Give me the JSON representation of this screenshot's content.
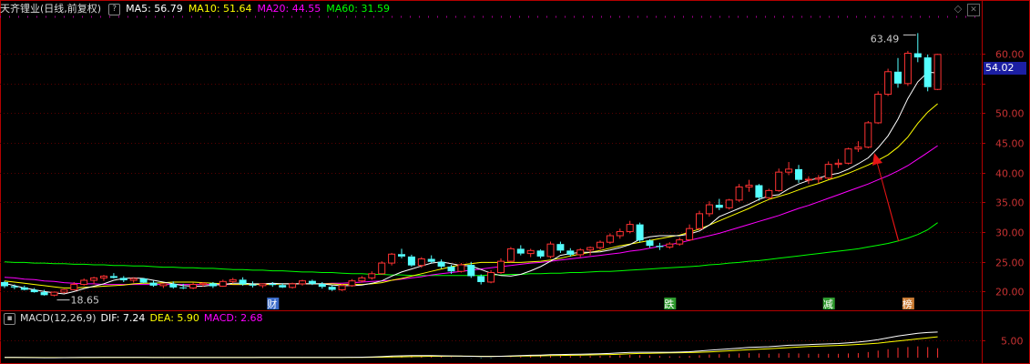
{
  "header": {
    "title": "天齐锂业(日线,前复权)",
    "ma5": "MA5: 56.79",
    "ma10": "MA10: 51.64",
    "ma20": "MA20: 44.55",
    "ma60": "MA60: 31.59"
  },
  "macd_header": {
    "title": "MACD(12,26,9)",
    "dif": "DIF: 7.24",
    "dea": "DEA: 5.90",
    "macd": "MACD: 2.68"
  },
  "last_price": "54.02",
  "colors": {
    "up": "#ff3232",
    "down": "#54ffff",
    "ma5": "#ffffff",
    "ma10": "#ffff00",
    "ma20": "#ff00ff",
    "ma60": "#00ff00",
    "axis": "#b40000",
    "axis_text": "#c83232",
    "arrow": "#e61414"
  },
  "chart_data": {
    "type": "candlestick",
    "ylim": [
      17,
      66
    ],
    "y_ticks": [
      20,
      25,
      30,
      35,
      40,
      45,
      50,
      55,
      60
    ],
    "y_tick_labels": [
      "20.00",
      "25.00",
      "30.00",
      "35.00",
      "40.00",
      "45.00",
      "50.00",
      "",
      "60.00"
    ],
    "annotations": {
      "max_label": "63.49",
      "min_label": "18.65"
    },
    "markers": [
      "财",
      "跌",
      "减",
      "榜"
    ],
    "ohlc": [
      [
        21.6,
        21.8,
        20.6,
        20.9
      ],
      [
        20.9,
        21.2,
        20.4,
        20.7
      ],
      [
        20.7,
        21.0,
        20.2,
        20.3
      ],
      [
        20.3,
        20.6,
        19.8,
        19.9
      ],
      [
        19.9,
        20.3,
        19.3,
        19.4
      ],
      [
        19.4,
        20.0,
        19.2,
        19.9
      ],
      [
        19.9,
        20.4,
        19.7,
        20.3
      ],
      [
        20.3,
        21.6,
        20.2,
        21.2
      ],
      [
        21.2,
        22.2,
        21.0,
        21.9
      ],
      [
        21.9,
        22.5,
        21.2,
        22.3
      ],
      [
        22.3,
        22.8,
        21.8,
        22.6
      ],
      [
        22.6,
        23.1,
        22.2,
        22.3
      ],
      [
        22.3,
        22.6,
        21.6,
        21.9
      ],
      [
        21.9,
        22.4,
        21.5,
        22.2
      ],
      [
        22.2,
        22.3,
        21.4,
        21.5
      ],
      [
        21.5,
        21.8,
        20.8,
        21.0
      ],
      [
        21.0,
        21.4,
        20.6,
        21.3
      ],
      [
        21.3,
        21.7,
        20.5,
        20.7
      ],
      [
        20.7,
        21.3,
        20.4,
        20.6
      ],
      [
        20.6,
        21.5,
        20.4,
        21.2
      ],
      [
        21.2,
        21.6,
        20.8,
        21.4
      ],
      [
        21.4,
        21.6,
        20.6,
        20.9
      ],
      [
        20.9,
        22.0,
        20.8,
        21.7
      ],
      [
        21.7,
        22.3,
        21.4,
        22.0
      ],
      [
        22.0,
        22.4,
        21.0,
        21.2
      ],
      [
        21.2,
        21.7,
        20.7,
        21.0
      ],
      [
        21.0,
        21.4,
        20.6,
        21.3
      ],
      [
        21.3,
        21.6,
        20.8,
        21.1
      ],
      [
        21.1,
        21.4,
        20.6,
        20.7
      ],
      [
        20.7,
        21.5,
        20.5,
        21.3
      ],
      [
        21.3,
        22.0,
        21.0,
        21.8
      ],
      [
        21.8,
        22.0,
        21.1,
        21.3
      ],
      [
        21.3,
        21.6,
        20.5,
        20.8
      ],
      [
        20.8,
        21.0,
        20.1,
        20.3
      ],
      [
        20.3,
        21.3,
        20.1,
        21.0
      ],
      [
        21.0,
        22.1,
        20.8,
        21.8
      ],
      [
        21.8,
        22.6,
        21.5,
        22.3
      ],
      [
        22.3,
        23.4,
        22.0,
        23.0
      ],
      [
        23.0,
        25.1,
        22.8,
        24.8
      ],
      [
        24.8,
        26.5,
        24.4,
        26.3
      ],
      [
        26.3,
        27.2,
        25.6,
        25.9
      ],
      [
        25.9,
        26.2,
        24.2,
        24.4
      ],
      [
        24.4,
        25.8,
        24.0,
        25.5
      ],
      [
        25.5,
        26.1,
        24.8,
        25.0
      ],
      [
        25.0,
        25.4,
        23.9,
        24.2
      ],
      [
        24.2,
        24.5,
        23.0,
        23.4
      ],
      [
        23.4,
        24.8,
        23.2,
        24.5
      ],
      [
        24.5,
        25.0,
        22.3,
        22.6
      ],
      [
        22.6,
        22.9,
        21.2,
        21.6
      ],
      [
        21.6,
        23.6,
        21.4,
        23.2
      ],
      [
        23.2,
        25.6,
        23.0,
        25.1
      ],
      [
        25.1,
        27.5,
        24.9,
        27.2
      ],
      [
        27.2,
        27.8,
        26.1,
        26.4
      ],
      [
        26.4,
        27.2,
        25.8,
        26.9
      ],
      [
        26.9,
        27.1,
        25.6,
        25.9
      ],
      [
        25.9,
        28.4,
        25.6,
        28.0
      ],
      [
        28.0,
        28.4,
        26.5,
        26.9
      ],
      [
        26.9,
        27.3,
        25.9,
        26.2
      ],
      [
        26.2,
        27.3,
        25.8,
        27.0
      ],
      [
        27.0,
        27.6,
        26.1,
        27.4
      ],
      [
        27.4,
        28.6,
        27.1,
        28.3
      ],
      [
        28.3,
        29.8,
        28.0,
        29.4
      ],
      [
        29.4,
        30.6,
        28.9,
        30.1
      ],
      [
        30.1,
        31.9,
        29.8,
        31.3
      ],
      [
        31.3,
        31.6,
        28.3,
        28.6
      ],
      [
        28.6,
        28.8,
        27.4,
        27.7
      ],
      [
        27.7,
        28.2,
        27.0,
        27.5
      ],
      [
        27.5,
        28.3,
        27.2,
        28.0
      ],
      [
        28.0,
        29.1,
        27.7,
        28.7
      ],
      [
        28.7,
        31.3,
        28.5,
        30.6
      ],
      [
        30.6,
        33.6,
        30.4,
        33.1
      ],
      [
        33.1,
        35.2,
        32.6,
        34.6
      ],
      [
        34.6,
        35.6,
        33.7,
        34.1
      ],
      [
        34.1,
        35.6,
        33.8,
        35.4
      ],
      [
        35.4,
        38.1,
        35.1,
        37.6
      ],
      [
        37.6,
        38.8,
        36.8,
        37.9
      ],
      [
        37.9,
        38.1,
        35.3,
        35.8
      ],
      [
        35.8,
        37.3,
        35.5,
        37.0
      ],
      [
        37.0,
        40.7,
        36.8,
        40.1
      ],
      [
        40.1,
        41.8,
        39.6,
        40.6
      ],
      [
        40.6,
        41.3,
        38.3,
        38.8
      ],
      [
        38.8,
        39.4,
        38.1,
        38.9
      ],
      [
        38.9,
        39.6,
        38.2,
        39.1
      ],
      [
        39.1,
        41.9,
        38.9,
        41.4
      ],
      [
        41.4,
        42.3,
        40.8,
        41.6
      ],
      [
        41.6,
        44.2,
        41.4,
        44.0
      ],
      [
        44.0,
        45.3,
        43.5,
        44.3
      ],
      [
        44.3,
        48.7,
        44.1,
        48.4
      ],
      [
        48.4,
        53.7,
        48.2,
        53.2
      ],
      [
        53.2,
        57.5,
        52.9,
        57.0
      ],
      [
        57.0,
        59.3,
        54.3,
        55.0
      ],
      [
        55.0,
        60.5,
        54.6,
        60.1
      ],
      [
        60.1,
        63.49,
        58.6,
        59.4
      ],
      [
        59.4,
        59.9,
        53.7,
        54.4
      ],
      [
        54.02,
        60.0,
        53.9,
        59.9
      ]
    ],
    "ma5": [
      21.4,
      21.0,
      20.6,
      20.3,
      20.0,
      19.8,
      19.6,
      20.0,
      20.5,
      20.9,
      21.3,
      21.9,
      22.2,
      22.3,
      22.2,
      21.9,
      21.6,
      21.3,
      21.0,
      20.9,
      20.9,
      21.1,
      21.2,
      21.4,
      21.4,
      21.3,
      21.3,
      21.4,
      21.3,
      21.3,
      21.3,
      21.3,
      21.3,
      21.1,
      21.0,
      21.0,
      21.1,
      21.4,
      21.8,
      22.6,
      23.3,
      23.8,
      24.3,
      24.8,
      25.0,
      24.7,
      24.4,
      24.3,
      23.7,
      23.1,
      22.7,
      22.6,
      22.9,
      23.5,
      24.2,
      25.1,
      26.1,
      26.4,
      26.6,
      26.6,
      26.7,
      27.0,
      27.4,
      27.9,
      28.8,
      29.2,
      29.4,
      29.4,
      29.4,
      29.7,
      30.2,
      31.2,
      32.6,
      33.3,
      34.0,
      34.7,
      35.5,
      36.1,
      36.3,
      37.3,
      38.1,
      38.7,
      39.1,
      39.6,
      39.9,
      40.6,
      41.5,
      42.5,
      44.2,
      46.2,
      49.0,
      52.5,
      55.3,
      56.9,
      56.8
    ],
    "ma10": [
      21.8,
      21.6,
      21.4,
      21.2,
      21.0,
      20.8,
      20.6,
      20.6,
      20.7,
      20.8,
      20.9,
      21.0,
      21.1,
      21.3,
      21.4,
      21.4,
      21.5,
      21.6,
      21.6,
      21.6,
      21.5,
      21.4,
      21.3,
      21.2,
      21.2,
      21.2,
      21.2,
      21.2,
      21.3,
      21.3,
      21.3,
      21.3,
      21.3,
      21.3,
      21.2,
      21.2,
      21.2,
      21.3,
      21.5,
      21.9,
      22.2,
      22.6,
      23.0,
      23.4,
      23.8,
      24.2,
      24.5,
      24.7,
      24.9,
      24.9,
      24.9,
      24.9,
      24.9,
      25.0,
      25.1,
      25.3,
      25.6,
      26.0,
      26.3,
      26.6,
      26.9,
      27.3,
      27.7,
      28.0,
      28.3,
      28.6,
      28.9,
      29.2,
      29.5,
      30.0,
      30.5,
      31.2,
      31.9,
      32.6,
      33.3,
      34.0,
      34.8,
      35.5,
      36.0,
      36.5,
      37.1,
      37.7,
      38.2,
      38.8,
      39.3,
      39.9,
      40.6,
      41.3,
      42.1,
      43.0,
      44.3,
      46.0,
      48.3,
      50.2,
      51.6
    ],
    "ma20": [
      22.4,
      22.3,
      22.1,
      22.0,
      21.8,
      21.7,
      21.5,
      21.4,
      21.3,
      21.3,
      21.2,
      21.2,
      21.2,
      21.2,
      21.2,
      21.2,
      21.2,
      21.2,
      21.2,
      21.2,
      21.2,
      21.2,
      21.2,
      21.2,
      21.2,
      21.2,
      21.2,
      21.3,
      21.3,
      21.3,
      21.3,
      21.3,
      21.3,
      21.4,
      21.4,
      21.5,
      21.6,
      21.7,
      21.8,
      21.9,
      22.1,
      22.3,
      22.5,
      22.8,
      23.0,
      23.2,
      23.4,
      23.6,
      23.8,
      24.0,
      24.2,
      24.4,
      24.6,
      24.8,
      24.9,
      25.1,
      25.3,
      25.5,
      25.7,
      25.9,
      26.1,
      26.3,
      26.5,
      26.8,
      27.0,
      27.3,
      27.6,
      27.9,
      28.2,
      28.6,
      29.0,
      29.4,
      29.8,
      30.3,
      30.8,
      31.3,
      31.8,
      32.3,
      32.8,
      33.4,
      34.0,
      34.5,
      35.1,
      35.7,
      36.3,
      36.9,
      37.5,
      38.1,
      38.8,
      39.5,
      40.3,
      41.2,
      42.3,
      43.4,
      44.55
    ],
    "ma60": [
      25.0,
      24.9,
      24.9,
      24.8,
      24.8,
      24.7,
      24.7,
      24.6,
      24.6,
      24.5,
      24.5,
      24.4,
      24.4,
      24.3,
      24.3,
      24.2,
      24.1,
      24.1,
      24.0,
      24.0,
      23.9,
      23.9,
      23.8,
      23.7,
      23.7,
      23.6,
      23.6,
      23.5,
      23.5,
      23.4,
      23.3,
      23.3,
      23.2,
      23.2,
      23.1,
      23.0,
      23.0,
      22.9,
      22.9,
      22.8,
      22.8,
      22.7,
      22.7,
      22.7,
      22.7,
      22.7,
      22.7,
      22.7,
      22.7,
      22.8,
      22.8,
      22.9,
      22.9,
      23.0,
      23.0,
      23.1,
      23.1,
      23.2,
      23.2,
      23.3,
      23.4,
      23.4,
      23.5,
      23.6,
      23.7,
      23.8,
      23.9,
      24.0,
      24.1,
      24.2,
      24.3,
      24.5,
      24.6,
      24.8,
      24.9,
      25.1,
      25.2,
      25.4,
      25.6,
      25.8,
      26.0,
      26.2,
      26.4,
      26.6,
      26.8,
      27.0,
      27.2,
      27.5,
      27.8,
      28.1,
      28.5,
      29.0,
      29.6,
      30.4,
      31.59
    ],
    "macd": {
      "ylim": [
        -1,
        9
      ],
      "y_ticks": [
        5
      ],
      "y_tick_labels": [
        "5.00"
      ],
      "dif": [
        0.1,
        0.08,
        0.05,
        0.02,
        0.0,
        0.0,
        0.02,
        0.05,
        0.08,
        0.1,
        0.1,
        0.1,
        0.1,
        0.1,
        0.08,
        0.06,
        0.05,
        0.05,
        0.05,
        0.05,
        0.05,
        0.05,
        0.05,
        0.06,
        0.06,
        0.06,
        0.07,
        0.07,
        0.07,
        0.08,
        0.08,
        0.08,
        0.08,
        0.08,
        0.1,
        0.12,
        0.15,
        0.2,
        0.3,
        0.45,
        0.55,
        0.6,
        0.6,
        0.6,
        0.55,
        0.5,
        0.45,
        0.4,
        0.35,
        0.35,
        0.4,
        0.5,
        0.6,
        0.7,
        0.75,
        0.85,
        0.9,
        0.95,
        1.0,
        1.05,
        1.1,
        1.2,
        1.35,
        1.5,
        1.55,
        1.55,
        1.55,
        1.55,
        1.6,
        1.7,
        1.9,
        2.1,
        2.3,
        2.5,
        2.7,
        2.9,
        3.0,
        3.1,
        3.3,
        3.5,
        3.6,
        3.7,
        3.8,
        3.9,
        4.0,
        4.2,
        4.4,
        4.7,
        5.1,
        5.6,
        6.1,
        6.5,
        6.9,
        7.1,
        7.24
      ],
      "dea": [
        0.1,
        0.09,
        0.08,
        0.07,
        0.06,
        0.05,
        0.05,
        0.05,
        0.05,
        0.06,
        0.07,
        0.08,
        0.08,
        0.08,
        0.08,
        0.08,
        0.08,
        0.07,
        0.07,
        0.07,
        0.07,
        0.07,
        0.07,
        0.07,
        0.07,
        0.07,
        0.07,
        0.07,
        0.07,
        0.07,
        0.07,
        0.08,
        0.08,
        0.08,
        0.08,
        0.09,
        0.1,
        0.12,
        0.15,
        0.2,
        0.25,
        0.3,
        0.35,
        0.4,
        0.42,
        0.43,
        0.44,
        0.43,
        0.42,
        0.41,
        0.41,
        0.42,
        0.45,
        0.5,
        0.55,
        0.6,
        0.65,
        0.7,
        0.75,
        0.8,
        0.85,
        0.9,
        1.0,
        1.1,
        1.2,
        1.25,
        1.3,
        1.35,
        1.4,
        1.45,
        1.55,
        1.65,
        1.8,
        1.95,
        2.1,
        2.25,
        2.4,
        2.55,
        2.7,
        2.85,
        3.0,
        3.15,
        3.25,
        3.35,
        3.45,
        3.6,
        3.75,
        3.9,
        4.1,
        4.4,
        4.7,
        5.0,
        5.3,
        5.6,
        5.9
      ]
    }
  }
}
